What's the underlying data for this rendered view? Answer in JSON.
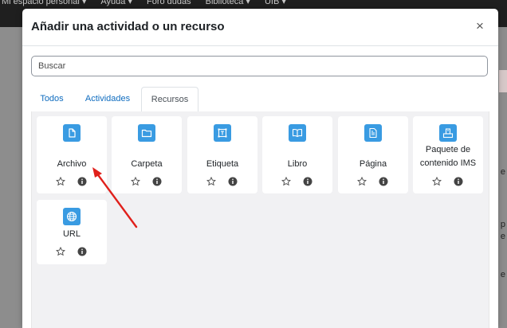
{
  "background": {
    "nav": [
      "Mi espacio personal ▾",
      "Ayuda ▾",
      "Foro dudas",
      "Biblioteca ▾",
      "UIB ▾"
    ],
    "right_letters": [
      "e",
      "p",
      "e",
      "e"
    ]
  },
  "modal": {
    "title": "Añadir una actividad o un recurso",
    "close_symbol": "×"
  },
  "search": {
    "placeholder": "Buscar"
  },
  "tabs": [
    {
      "label": "Todos",
      "active": false
    },
    {
      "label": "Actividades",
      "active": false
    },
    {
      "label": "Recursos",
      "active": true
    }
  ],
  "resources": [
    {
      "name": "Archivo",
      "icon": "file-icon"
    },
    {
      "name": "Carpeta",
      "icon": "folder-icon"
    },
    {
      "name": "Etiqueta",
      "icon": "label-icon"
    },
    {
      "name": "Libro",
      "icon": "book-icon"
    },
    {
      "name": "Página",
      "icon": "page-icon"
    },
    {
      "name": "Paquete de contenido IMS",
      "icon": "ims-package-icon"
    },
    {
      "name": "URL",
      "icon": "globe-icon"
    }
  ],
  "colors": {
    "accent": "#0f6cbf",
    "icon_bg": "#399be2",
    "annotation_arrow": "#e0201b"
  }
}
